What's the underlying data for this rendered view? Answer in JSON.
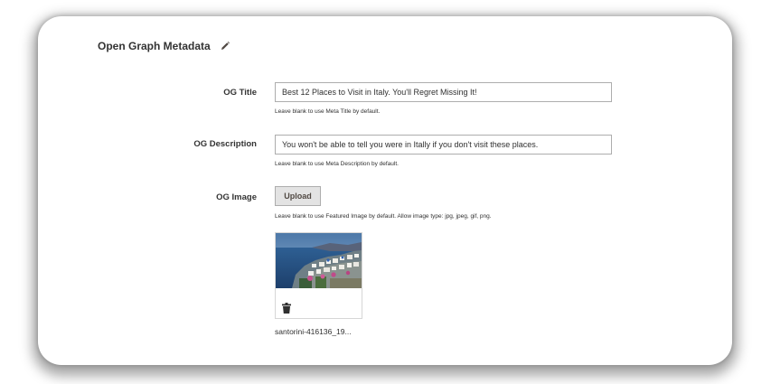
{
  "section": {
    "title": "Open Graph Metadata",
    "edit_icon": "pencil-icon"
  },
  "og_title": {
    "label": "OG Title",
    "value": "Best 12 Places to Visit in Italy. You'll Regret Missing It!",
    "note": "Leave blank to use Meta Title by default."
  },
  "og_description": {
    "label": "OG Description",
    "value": "You won't be able to tell you were in Itally if you don't visit these places.",
    "note": "Leave blank to use Meta Description by default."
  },
  "og_image": {
    "label": "OG Image",
    "upload_label": "Upload",
    "note": "Leave blank to use Featured Image by default. Allow image type: jpg, jpeg, gif, png.",
    "filename": "santorini-416136_19...",
    "delete_icon": "trash-icon"
  }
}
